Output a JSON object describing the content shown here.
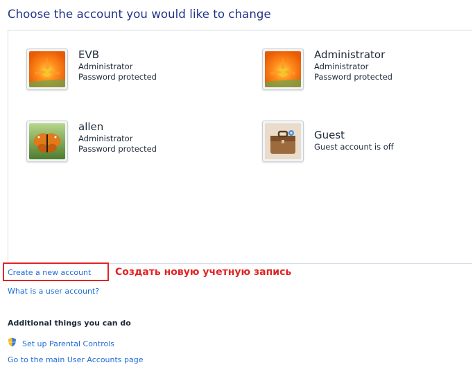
{
  "heading": "Choose the account you would like to change",
  "accounts": [
    {
      "name": "EVB",
      "line1": "Administrator",
      "line2": "Password protected",
      "picture": "orange-flower-icon"
    },
    {
      "name": "Administrator",
      "line1": "Administrator",
      "line2": "Password protected",
      "picture": "orange-flower-icon"
    },
    {
      "name": "allen",
      "line1": "Administrator",
      "line2": "Password protected",
      "picture": "butterfly-icon"
    },
    {
      "name": "Guest",
      "line1": "Guest account is off",
      "line2": "",
      "picture": "briefcase-icon"
    }
  ],
  "links": {
    "create": "Create a new account",
    "what": "What is a user account?",
    "parental": "Set up Parental Controls",
    "main": "Go to the main User Accounts page"
  },
  "annotation": "Создать новую учетную запись",
  "additional_heading": "Additional things you can do",
  "colors": {
    "link": "#1e6cd6",
    "heading": "#1e3287",
    "highlight": "#e02424"
  }
}
